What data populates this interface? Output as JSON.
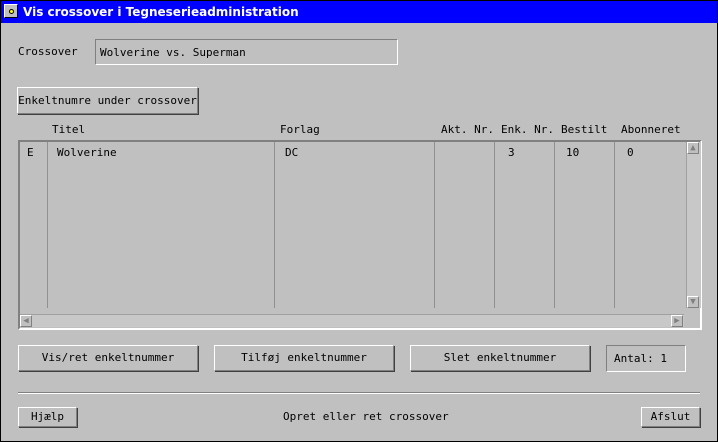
{
  "window": {
    "title": "Vis crossover i Tegneserieadministration"
  },
  "crossover": {
    "label": "Crossover",
    "value": "Wolverine vs. Superman"
  },
  "buttons": {
    "enkeltnumre": "Enkeltnumre under crossover",
    "visret": "Vis/ret enkeltnummer",
    "tilfoej": "Tilføj enkeltnummer",
    "slet": "Slet enkeltnummer",
    "hjaelp": "Hjælp",
    "afslut": "Afslut"
  },
  "table": {
    "headers": [
      "Titel",
      "Forlag",
      "Akt. Nr.",
      "Enk. Nr.",
      "Bestilt",
      "Abonneret"
    ],
    "rows": [
      {
        "marker": "E",
        "titel": "Wolverine",
        "forlag": "DC",
        "akt": "",
        "enk": "3",
        "bestilt": "10",
        "abonneret": "0"
      }
    ]
  },
  "antal": {
    "text": "Antal: 1"
  },
  "status": {
    "text": "Opret eller ret crossover"
  }
}
